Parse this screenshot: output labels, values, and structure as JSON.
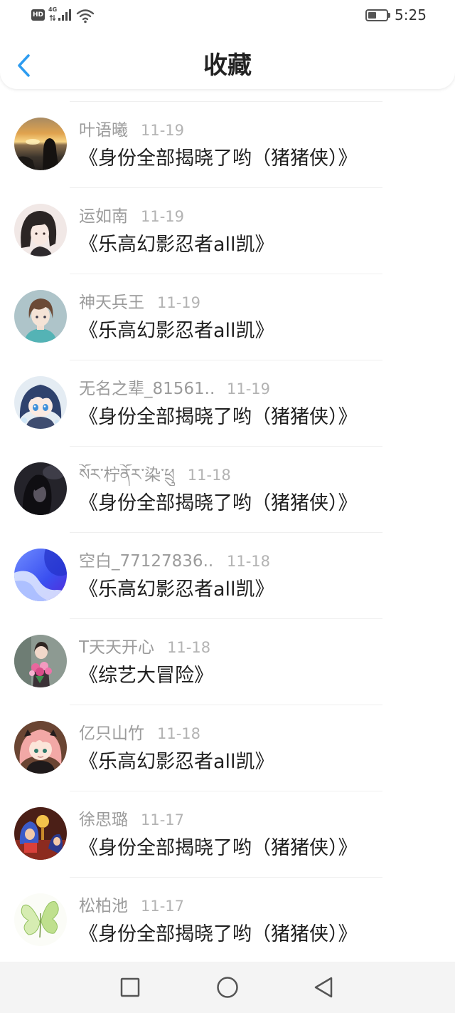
{
  "status_bar": {
    "hd_badge": "HD",
    "network_type": "4G",
    "time": "5:25",
    "battery_percent": 45,
    "icons": {
      "signal": "signal-icon",
      "wifi": "wifi-icon",
      "battery": "battery-icon"
    }
  },
  "header": {
    "title": "收藏",
    "back_icon": "chevron-left-icon",
    "accent_color": "#2d9cf0"
  },
  "favorites": {
    "items": [
      {
        "name": "叶语曦",
        "date": "11-19",
        "title": "《身份全部揭晓了哟（猪猪侠）》"
      },
      {
        "name": "运如南",
        "date": "11-19",
        "title": "《乐高幻影忍者all凯》"
      },
      {
        "name": "神天兵王",
        "date": "11-19",
        "title": "《乐高幻影忍者all凯》"
      },
      {
        "name": "无名之辈_81561...",
        "date": "11-19",
        "title": "《身份全部揭晓了哟（猪猪侠）》"
      },
      {
        "name": "སོར་柠ནོར་染་ཕྲུ",
        "date": "11-18",
        "title": "《身份全部揭晓了哟（猪猪侠）》"
      },
      {
        "name": "空白_77127836...",
        "date": "11-18",
        "title": "《乐高幻影忍者all凯》"
      },
      {
        "name": "T天天开心",
        "date": "11-18",
        "title": "《综艺大冒险》"
      },
      {
        "name": "亿只山竹",
        "date": "11-18",
        "title": "《乐高幻影忍者all凯》"
      },
      {
        "name": "徐思璐",
        "date": "11-17",
        "title": "《身份全部揭晓了哟（猪猪侠）》"
      },
      {
        "name": "松柏池",
        "date": "11-17",
        "title": "《身份全部揭晓了哟（猪猪侠）》"
      }
    ]
  },
  "nav_bar": {
    "icons": {
      "recents": "square-recents-icon",
      "home": "circle-home-icon",
      "back": "triangle-back-icon"
    }
  }
}
